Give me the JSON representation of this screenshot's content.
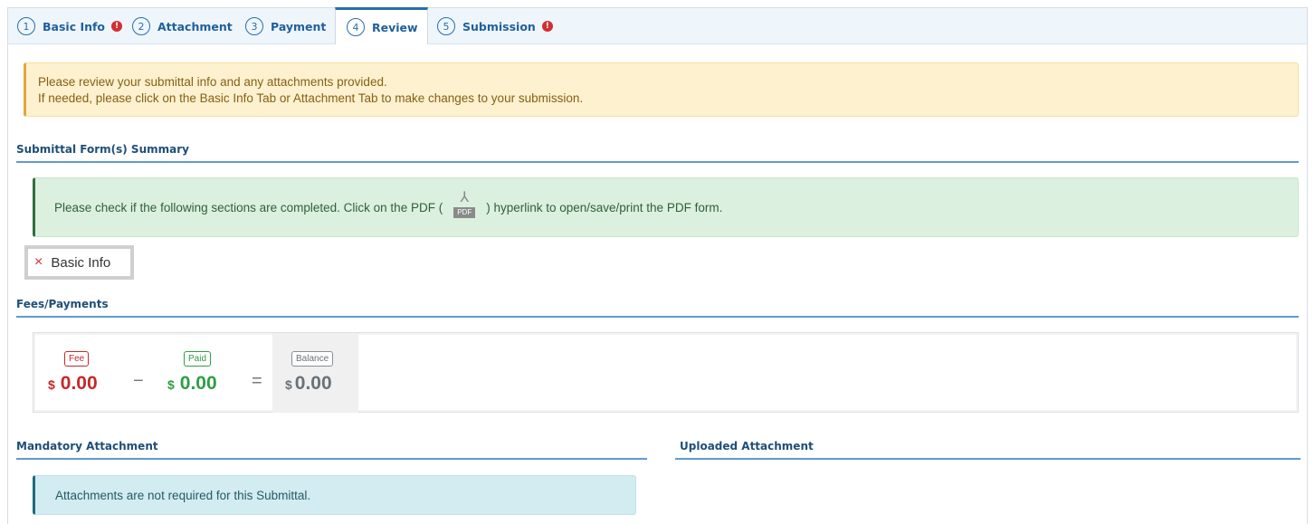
{
  "tabs": [
    {
      "num": "1",
      "label": "Basic Info",
      "error": true
    },
    {
      "num": "2",
      "label": "Attachment",
      "error": false
    },
    {
      "num": "3",
      "label": "Payment",
      "error": false
    },
    {
      "num": "4",
      "label": "Review",
      "error": false,
      "active": true
    },
    {
      "num": "5",
      "label": "Submission",
      "error": true
    }
  ],
  "error_glyph": "!",
  "warning": {
    "line1": "Please review your submittal info and any attachments provided.",
    "line2": "If needed, please click on the Basic Info Tab or Attachment Tab to make changes to your submission."
  },
  "summary": {
    "title": "Submittal Form(s) Summary",
    "note_before": "Please check if the following sections are completed. Click on the PDF (",
    "note_after": ") hyperlink to open/save/print the PDF form.",
    "pdf_label": "PDF",
    "items": [
      {
        "label": "Basic Info",
        "status_glyph": "×",
        "status": "incomplete"
      }
    ]
  },
  "fees": {
    "title": "Fees/Payments",
    "fee_label": "Fee",
    "fee_currency": "$",
    "fee_amount": "0.00",
    "paid_label": "Paid",
    "paid_currency": "$",
    "paid_amount": "0.00",
    "balance_label": "Balance",
    "balance_currency": "$",
    "balance_amount": "0.00",
    "minus": "−",
    "equals": "="
  },
  "mandatory": {
    "title": "Mandatory Attachment",
    "note": "Attachments are not required for this Submittal."
  },
  "uploaded": {
    "title": "Uploaded Attachment"
  },
  "colors": {
    "accent": "#2a6db0",
    "error": "#d32f2f",
    "fee": "#c62828",
    "paid": "#2e9e44",
    "balance": "#6b7178"
  }
}
